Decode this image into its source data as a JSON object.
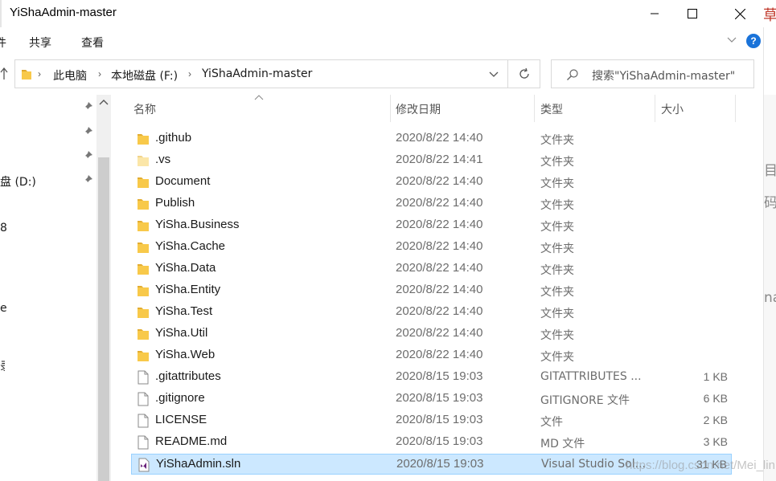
{
  "window": {
    "title": "YiShaAdmin-master"
  },
  "ribbon": {
    "tabs": [
      "共享",
      "查看"
    ],
    "help": "?"
  },
  "address": {
    "crumbs": [
      "此电脑",
      "本地磁盘 (F:)",
      "YiShaAdmin-master"
    ]
  },
  "search": {
    "placeholder": "搜索\"YiShaAdmin-master\""
  },
  "nav": {
    "items": [
      "盘 (D:)",
      "8",
      "e",
      "录"
    ]
  },
  "columns": {
    "name": "名称",
    "date": "修改日期",
    "type": "类型",
    "size": "大小"
  },
  "files": [
    {
      "name": ".github",
      "date": "2020/8/22 14:40",
      "type": "文件夹",
      "size": "",
      "icon": "folder-icon"
    },
    {
      "name": ".vs",
      "date": "2020/8/22 14:41",
      "type": "文件夹",
      "size": "",
      "icon": "hidden-folder-icon"
    },
    {
      "name": "Document",
      "date": "2020/8/22 14:40",
      "type": "文件夹",
      "size": "",
      "icon": "folder-icon"
    },
    {
      "name": "Publish",
      "date": "2020/8/22 14:40",
      "type": "文件夹",
      "size": "",
      "icon": "folder-icon"
    },
    {
      "name": "YiSha.Business",
      "date": "2020/8/22 14:40",
      "type": "文件夹",
      "size": "",
      "icon": "folder-icon"
    },
    {
      "name": "YiSha.Cache",
      "date": "2020/8/22 14:40",
      "type": "文件夹",
      "size": "",
      "icon": "folder-icon"
    },
    {
      "name": "YiSha.Data",
      "date": "2020/8/22 14:40",
      "type": "文件夹",
      "size": "",
      "icon": "folder-icon"
    },
    {
      "name": "YiSha.Entity",
      "date": "2020/8/22 14:40",
      "type": "文件夹",
      "size": "",
      "icon": "folder-icon"
    },
    {
      "name": "YiSha.Test",
      "date": "2020/8/22 14:40",
      "type": "文件夹",
      "size": "",
      "icon": "folder-icon"
    },
    {
      "name": "YiSha.Util",
      "date": "2020/8/22 14:40",
      "type": "文件夹",
      "size": "",
      "icon": "folder-icon"
    },
    {
      "name": "YiSha.Web",
      "date": "2020/8/22 14:40",
      "type": "文件夹",
      "size": "",
      "icon": "folder-icon"
    },
    {
      "name": ".gitattributes",
      "date": "2020/8/15 19:03",
      "type": "GITATTRIBUTES ...",
      "size": "1 KB",
      "icon": "file-icon"
    },
    {
      "name": ".gitignore",
      "date": "2020/8/15 19:03",
      "type": "GITIGNORE 文件",
      "size": "6 KB",
      "icon": "file-icon"
    },
    {
      "name": "LICENSE",
      "date": "2020/8/15 19:03",
      "type": "文件",
      "size": "2 KB",
      "icon": "file-icon"
    },
    {
      "name": "README.md",
      "date": "2020/8/15 19:03",
      "type": "MD 文件",
      "size": "3 KB",
      "icon": "file-icon"
    },
    {
      "name": "YiShaAdmin.sln",
      "date": "2020/8/15 19:03",
      "type": "Visual Studio Sol...",
      "size": "31 KB",
      "icon": "visual-studio-solution-icon",
      "selected": true
    }
  ],
  "background": {
    "edge_chars": [
      "草",
      "目",
      "码",
      "na"
    ]
  },
  "watermark": "https://blog.csdn.net/Mei_lin",
  "colors": {
    "folder": "#f8c94a",
    "selection": "#cce8ff",
    "help": "#1a73d9"
  }
}
